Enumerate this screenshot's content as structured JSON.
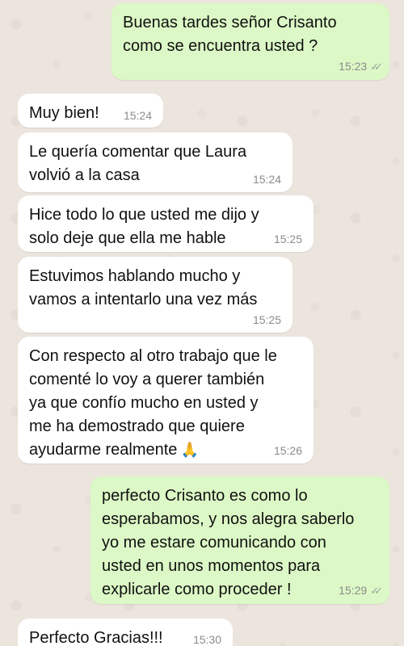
{
  "messages": [
    {
      "direction": "out",
      "text": "Buenas tardes señor Crisanto\ncomo se encuentra usted ?",
      "time": "15:23",
      "status": "read-ticks-icon"
    },
    {
      "direction": "in",
      "text": "Muy bien!",
      "time": "15:24"
    },
    {
      "direction": "in",
      "text": "Le quería comentar que Laura\nvolvió a la casa",
      "time": "15:24"
    },
    {
      "direction": "in",
      "text": "Hice todo lo que usted me dijo y\nsolo deje que ella me hable",
      "time": "15:25"
    },
    {
      "direction": "in",
      "text": "Estuvimos hablando mucho y\nvamos a intentarlo una vez más",
      "time": "15:25"
    },
    {
      "direction": "in",
      "text": "Con respecto al otro trabajo que le\ncomenté lo voy a querer también\nya que confío mucho en usted y\nme ha demostrado que quiere\nayudarme realmente",
      "emoji": "🙏",
      "emoji_name": "praying-hands-icon",
      "time": "15:26"
    },
    {
      "direction": "out",
      "text": "perfecto Crisanto es como lo\nesperabamos, y nos alegra saberlo\nyo me estare comunicando con\nusted en unos momentos para\nexplicarle como proceder !",
      "time": "15:29",
      "status": "read-ticks-icon"
    },
    {
      "direction": "in",
      "text": "Perfecto Gracias!!!",
      "time": "15:30"
    }
  ],
  "colors": {
    "background": "#ece5dd",
    "incoming": "#ffffff",
    "outgoing": "#dcf8c6",
    "timestamp": "#8b8b8b"
  }
}
